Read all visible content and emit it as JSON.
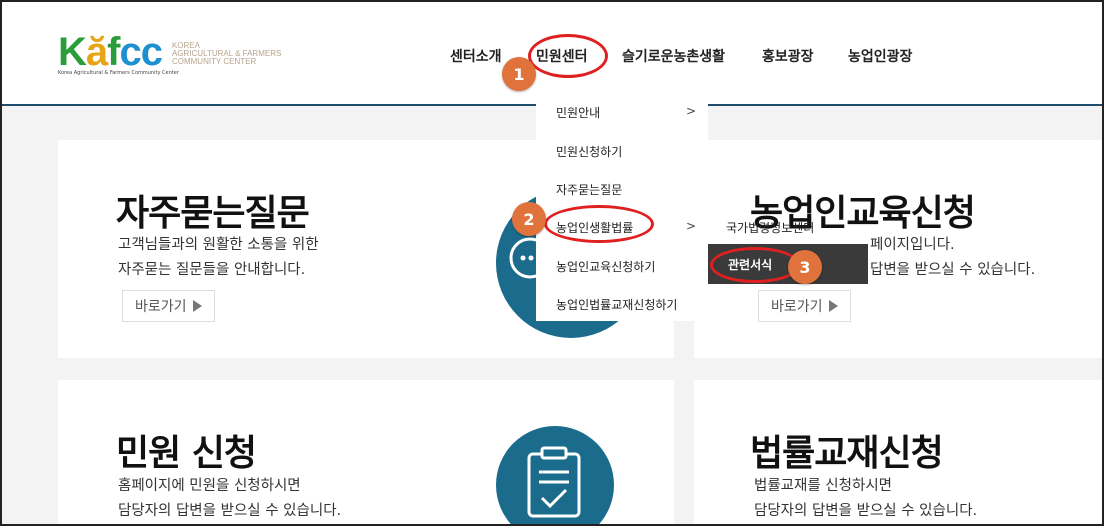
{
  "logo": {
    "letters": [
      "K",
      "ă",
      "f",
      "cc"
    ],
    "tagline": "Korea Agricultural & Farmers Community Center",
    "sub_lines": [
      "KOREA",
      "AGRICULTURAL & FARMERS",
      "COMMUNITY CENTER"
    ]
  },
  "nav": {
    "items": [
      "센터소개",
      "민원센터",
      "슬기로운농촌생활",
      "홍보광장",
      "농업인광장"
    ]
  },
  "dropdown": {
    "items": [
      "민원안내",
      "민원신청하기",
      "자주묻는질문",
      "농업인생활법률",
      "농업인교육신청하기",
      "농업인법률교재신청하기"
    ],
    "arrow": ">"
  },
  "submenu": {
    "items": [
      "국가법령정보센터",
      "관련서식"
    ]
  },
  "cards": {
    "faq": {
      "title": "자주묻는질문",
      "desc1": "고객님들과의 원활한 소통을 위한",
      "desc2": "자주묻는 질문들을 안내합니다.",
      "button": "바로가기"
    },
    "edu": {
      "title": "농업인교육신청",
      "desc1": "페이지입니다.",
      "desc2": "답변을 받으실 수 있습니다.",
      "button": "바로가기"
    },
    "civil": {
      "title": "민원 신청",
      "desc1": "홈페이지에 민원을 신청하시면",
      "desc2": "담당자의 답변을 받으실 수 있습니다."
    },
    "textbook": {
      "title": "법률교재신청",
      "desc1": "법률교재를 신청하시면",
      "desc2": "담당자의 답변을 받으실 수 있습니다."
    }
  },
  "annotations": {
    "badge1": "1",
    "badge2": "2",
    "badge3": "3"
  },
  "colors": {
    "accent_blue": "#1a6b8c",
    "annotation_red": "#e02020",
    "badge_orange": "#e0733b"
  }
}
